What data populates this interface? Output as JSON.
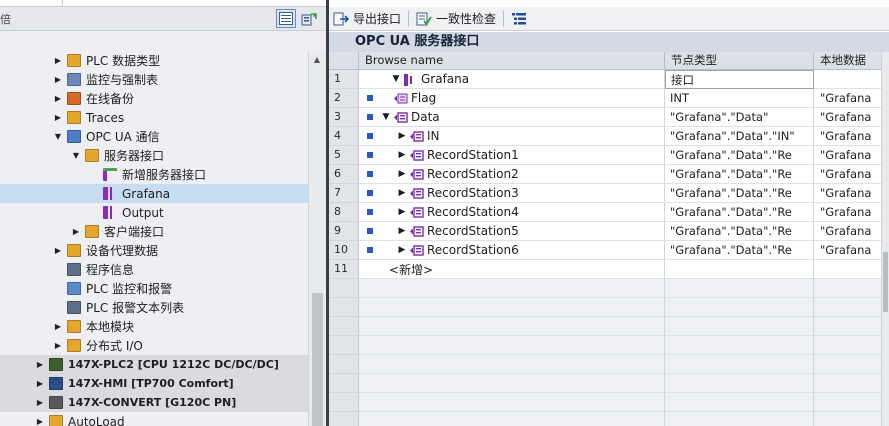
{
  "left_panel": {
    "toolbar_cut_label": "倍",
    "tree": [
      {
        "label": "PLC 数据类型",
        "indent": 2,
        "arrow": "right",
        "icon": "folder-icon",
        "color": "#e3a62f"
      },
      {
        "label": "监控与强制表",
        "indent": 2,
        "arrow": "right",
        "icon": "watch-table-icon",
        "color": "#6d87b8"
      },
      {
        "label": "在线备份",
        "indent": 2,
        "arrow": "right",
        "icon": "online-backup-icon",
        "color": "#d46a2a"
      },
      {
        "label": "Traces",
        "indent": 2,
        "arrow": "right",
        "icon": "trace-folder-icon",
        "color": "#e3a62f"
      },
      {
        "label": "OPC UA 通信",
        "indent": 2,
        "arrow": "down",
        "icon": "opc-ua-icon",
        "color": "#4c7fc4"
      },
      {
        "label": "服务器接口",
        "indent": 3,
        "arrow": "down",
        "icon": "server-interface-icon",
        "color": "#e3a62f"
      },
      {
        "label": "新增服务器接口",
        "indent": 4,
        "arrow": "none",
        "icon": "add-interface-icon",
        "color": "#4aa24a"
      },
      {
        "label": "Grafana",
        "indent": 4,
        "arrow": "none",
        "icon": "interface-icon",
        "color": "#8a2ab8",
        "selected": true
      },
      {
        "label": "Output",
        "indent": 4,
        "arrow": "none",
        "icon": "interface-icon",
        "color": "#8a2ab8"
      },
      {
        "label": "客户端接口",
        "indent": 3,
        "arrow": "right",
        "icon": "client-interface-icon",
        "color": "#e3a62f"
      },
      {
        "label": "设备代理数据",
        "indent": 2,
        "arrow": "right",
        "icon": "device-proxy-icon",
        "color": "#e3a62f"
      },
      {
        "label": "程序信息",
        "indent": 2,
        "arrow": "none",
        "icon": "program-info-icon",
        "color": "#5d6e86"
      },
      {
        "label": "PLC 监控和报警",
        "indent": 2,
        "arrow": "none",
        "icon": "plc-alarm-icon",
        "color": "#5a8ac8"
      },
      {
        "label": "PLC 报警文本列表",
        "indent": 2,
        "arrow": "none",
        "icon": "alarm-text-icon",
        "color": "#5d6e86"
      },
      {
        "label": "本地模块",
        "indent": 2,
        "arrow": "right",
        "icon": "local-modules-icon",
        "color": "#e3a62f"
      },
      {
        "label": "分布式 I/O",
        "indent": 2,
        "arrow": "right",
        "icon": "distributed-io-icon",
        "color": "#e3a62f"
      },
      {
        "label": "147X-PLC2 [CPU 1212C DC/DC/DC]",
        "indent": 1,
        "arrow": "right",
        "icon": "plc-device-icon",
        "color": "#3f5f2e",
        "device": true
      },
      {
        "label": "147X-HMI [TP700 Comfort]",
        "indent": 1,
        "arrow": "right",
        "icon": "hmi-device-icon",
        "color": "#2e4e8a",
        "device": true
      },
      {
        "label": "147X-CONVERT [G120C PN]",
        "indent": 1,
        "arrow": "right",
        "icon": "drive-device-icon",
        "color": "#5a5a5a",
        "device": true
      },
      {
        "label": "AutoLoad",
        "indent": 1,
        "arrow": "right",
        "icon": "autoload-icon",
        "color": "#e3a62f",
        "device": false
      }
    ]
  },
  "toolbar": {
    "export_label": "导出接口",
    "consistency_label": "一致性检查"
  },
  "editor": {
    "title": "OPC UA 服务器接口",
    "columns": [
      "Browse name",
      "节点类型",
      "本地数据"
    ],
    "rows": [
      {
        "num": "1",
        "level": 0,
        "dot": false,
        "expand": "down",
        "icon": "interface-icon",
        "name": "Grafana",
        "type": "接口",
        "local": ""
      },
      {
        "num": "2",
        "level": 1,
        "dot": true,
        "expand": "none",
        "icon": "variable-icon",
        "name": "Flag",
        "type": "INT",
        "local": "\"Grafana"
      },
      {
        "num": "3",
        "level": 1,
        "dot": true,
        "expand": "down",
        "icon": "object-icon",
        "name": "Data",
        "type": "\"Grafana\".\"Data\"",
        "local": "\"Grafana"
      },
      {
        "num": "4",
        "level": 2,
        "dot": true,
        "expand": "right",
        "icon": "object-icon",
        "name": "IN",
        "type": "\"Grafana\".\"Data\".\"IN\"",
        "local": "\"Grafana"
      },
      {
        "num": "5",
        "level": 2,
        "dot": true,
        "expand": "right",
        "icon": "object-icon",
        "name": "RecordStation1",
        "type": "\"Grafana\".\"Data\".\"Re",
        "local": "\"Grafana"
      },
      {
        "num": "6",
        "level": 2,
        "dot": true,
        "expand": "right",
        "icon": "object-icon",
        "name": "RecordStation2",
        "type": "\"Grafana\".\"Data\".\"Re",
        "local": "\"Grafana"
      },
      {
        "num": "7",
        "level": 2,
        "dot": true,
        "expand": "right",
        "icon": "object-icon",
        "name": "RecordStation3",
        "type": "\"Grafana\".\"Data\".\"Re",
        "local": "\"Grafana"
      },
      {
        "num": "8",
        "level": 2,
        "dot": true,
        "expand": "right",
        "icon": "object-icon",
        "name": "RecordStation4",
        "type": "\"Grafana\".\"Data\".\"Re",
        "local": "\"Grafana"
      },
      {
        "num": "9",
        "level": 2,
        "dot": true,
        "expand": "right",
        "icon": "object-icon",
        "name": "RecordStation5",
        "type": "\"Grafana\".\"Data\".\"Re",
        "local": "\"Grafana"
      },
      {
        "num": "10",
        "level": 2,
        "dot": true,
        "expand": "right",
        "icon": "object-icon",
        "name": "RecordStation6",
        "type": "\"Grafana\".\"Data\".\"Re",
        "local": "\"Grafana"
      }
    ],
    "new_row": {
      "num": "11",
      "label": "<新增>"
    }
  },
  "colors": {
    "node_icon_purple": "#7a2bb0",
    "row_dot_blue": "#2b57c9",
    "selection_blue": "#c7ddf2"
  }
}
